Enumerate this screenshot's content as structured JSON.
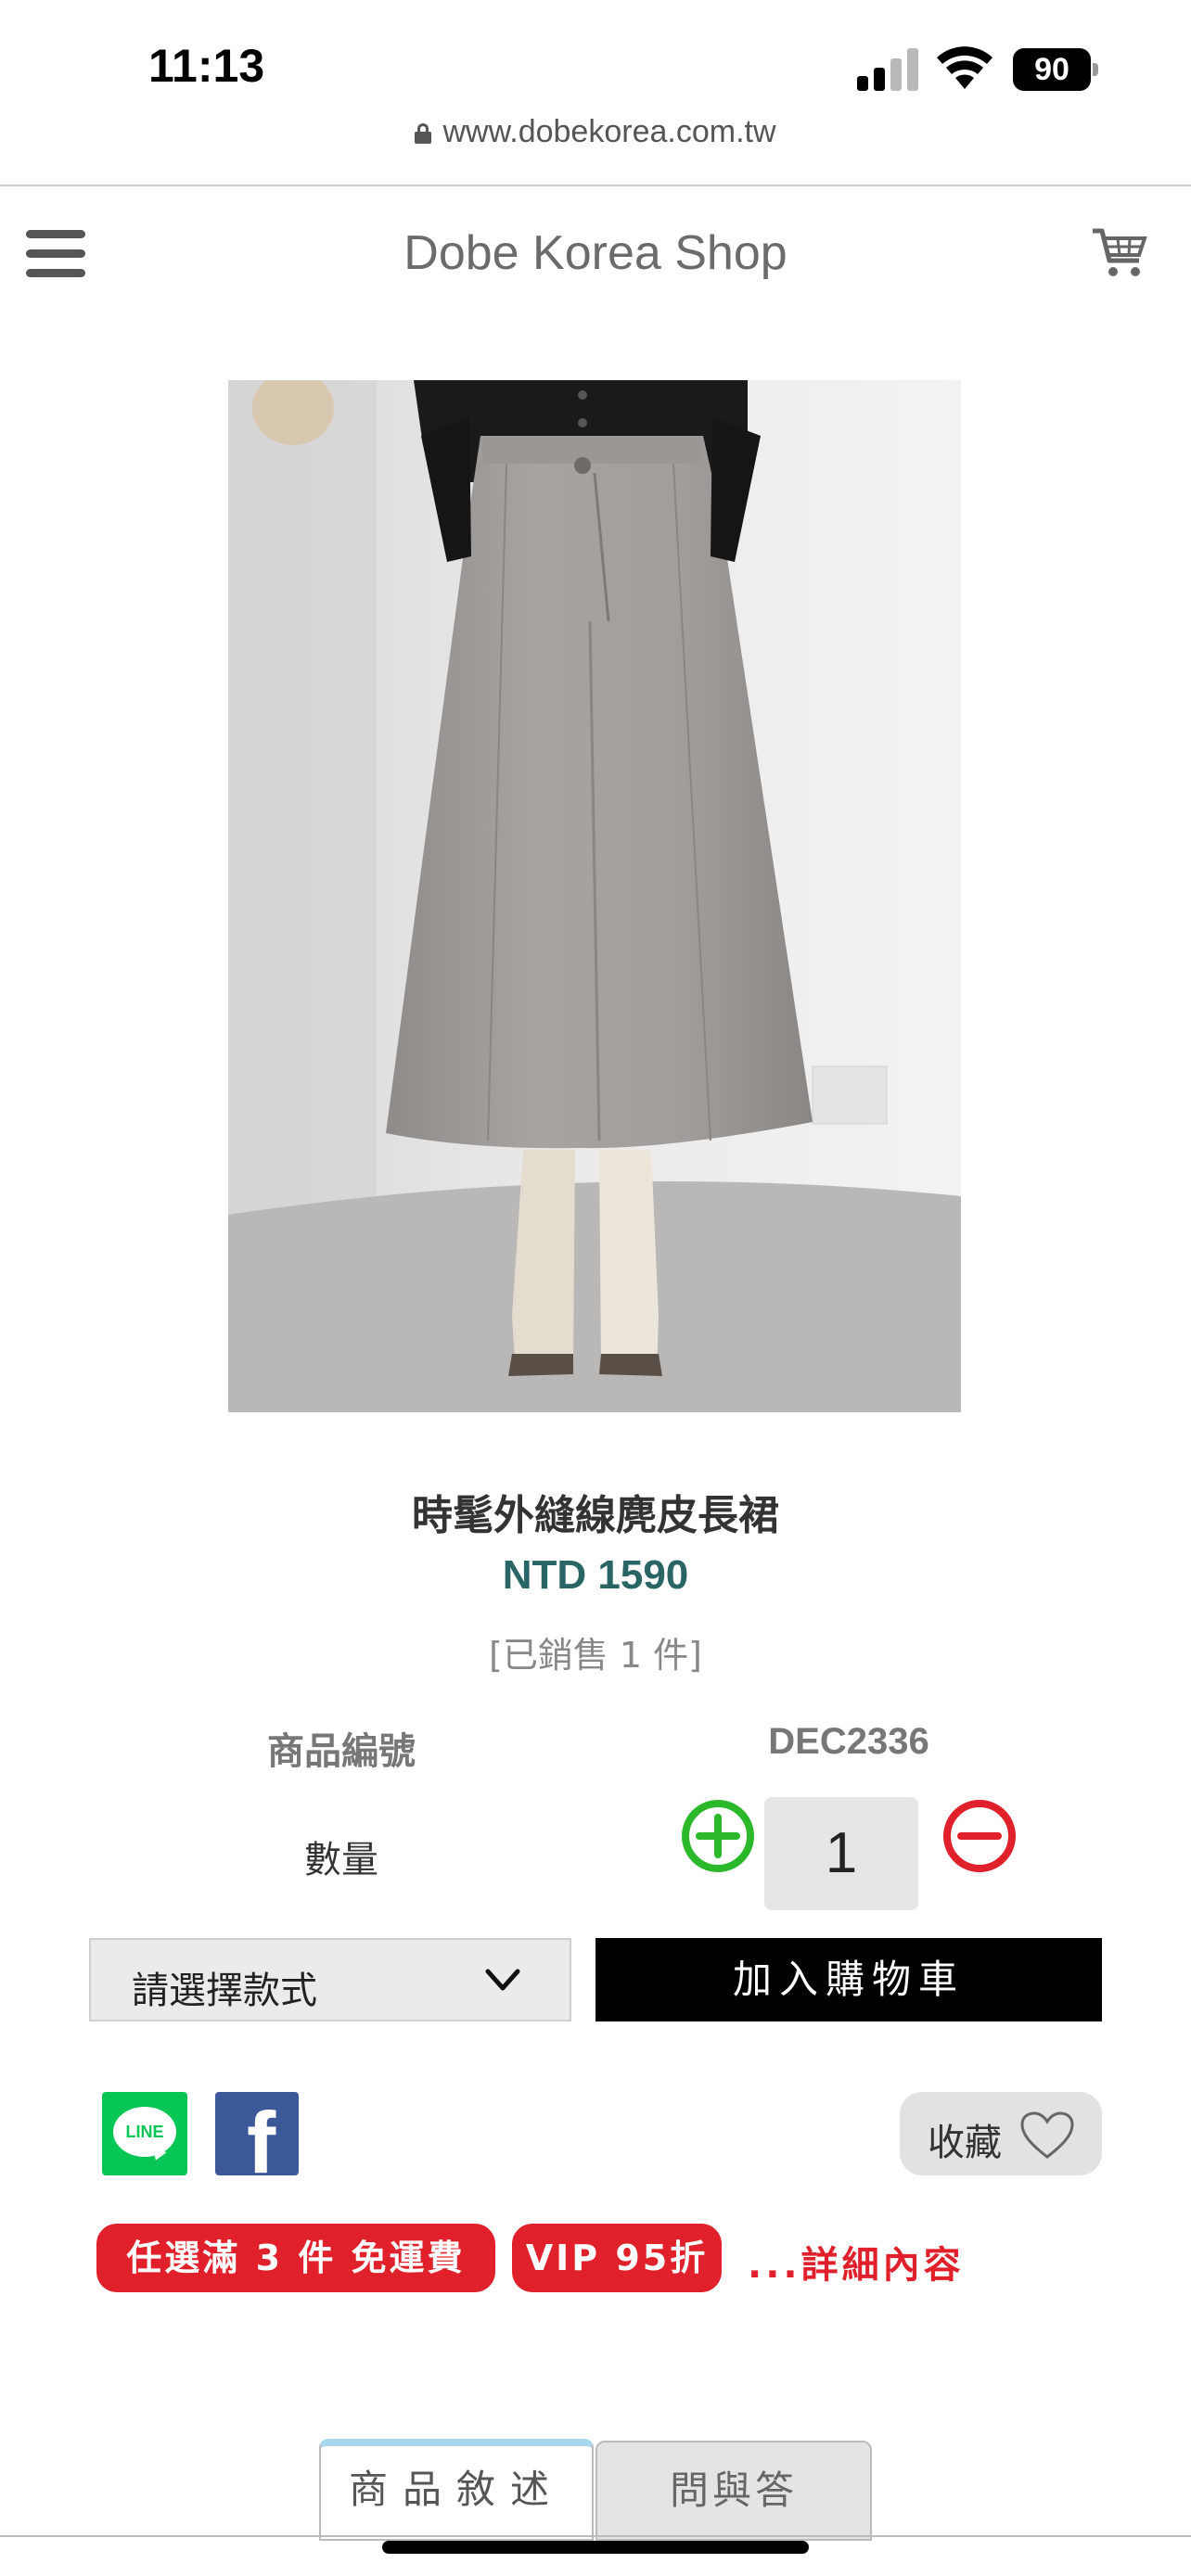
{
  "status_bar": {
    "time": "11:13",
    "battery": "90"
  },
  "browser": {
    "url": "www.dobekorea.com.tw"
  },
  "header": {
    "shop_title": "Dobe Korea Shop",
    "menu_icon": "hamburger-menu-icon",
    "cart_icon": "shopping-cart-icon"
  },
  "product": {
    "name": "時髦外縫線麂皮長裙",
    "price": "NTD 1590",
    "sold": "[已銷售 1 件]",
    "sku_label": "商品編號",
    "sku_value": "DEC2336",
    "qty_label": "數量",
    "qty_value": "1",
    "style_select_label": "請選擇款式",
    "add_to_cart": "加入購物車",
    "favorite_label": "收藏",
    "line_label": "LINE"
  },
  "promotions": {
    "free_shipping": "任選滿 3 件 免運費",
    "vip": "VIP 95折",
    "details_link": "...詳細內容"
  },
  "tabs": [
    {
      "label": "商品敘述"
    },
    {
      "label": "問與答"
    }
  ],
  "colors": {
    "price": "#2a6565",
    "promo_red": "#e0202a",
    "add_to_cart_bg": "#000000",
    "line_green": "#06c755",
    "facebook_blue": "#3b5998",
    "plus_green": "#2bb92b",
    "minus_red": "#e0202a"
  }
}
